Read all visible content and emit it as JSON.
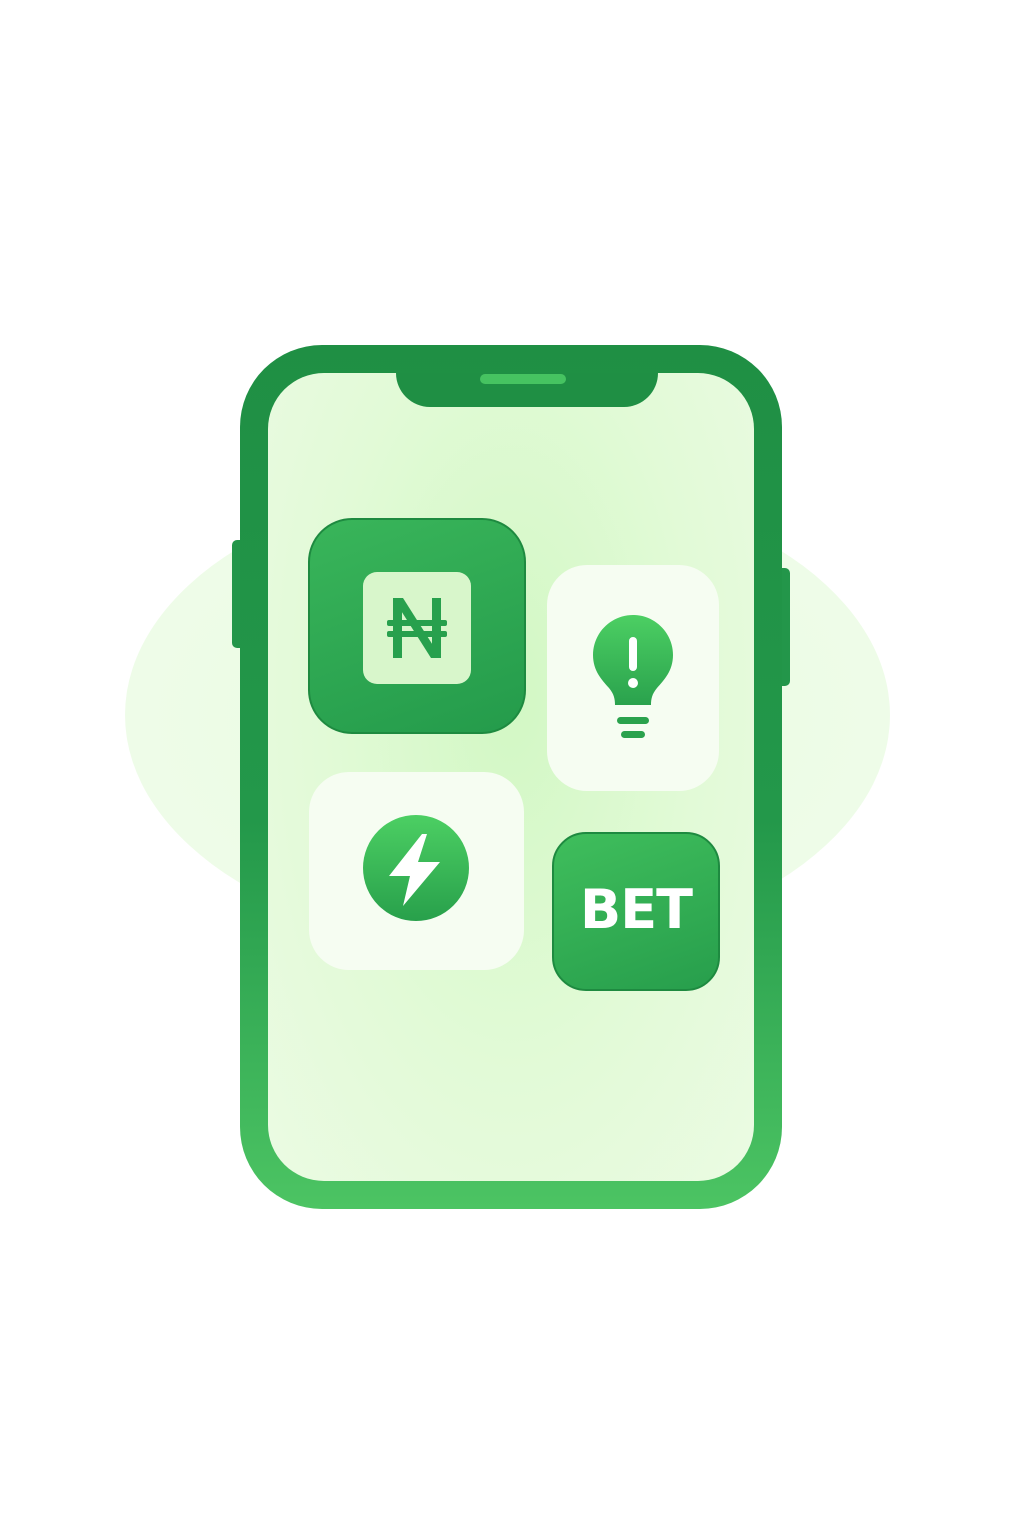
{
  "illustration": {
    "tiles": {
      "currency": {
        "icon": "naira-icon"
      },
      "idea": {
        "icon": "lightbulb-exclamation-icon"
      },
      "energy": {
        "icon": "lightning-bolt-icon"
      },
      "bet": {
        "label": "BET"
      }
    },
    "colors": {
      "phone_frame": "#1f8f44",
      "phone_frame_bottom": "#4cc463",
      "screen": "#e2fad7",
      "accent": "#3dbb5a",
      "tile_light": "#f6fdf2",
      "background_blob": "#eefce8"
    }
  }
}
